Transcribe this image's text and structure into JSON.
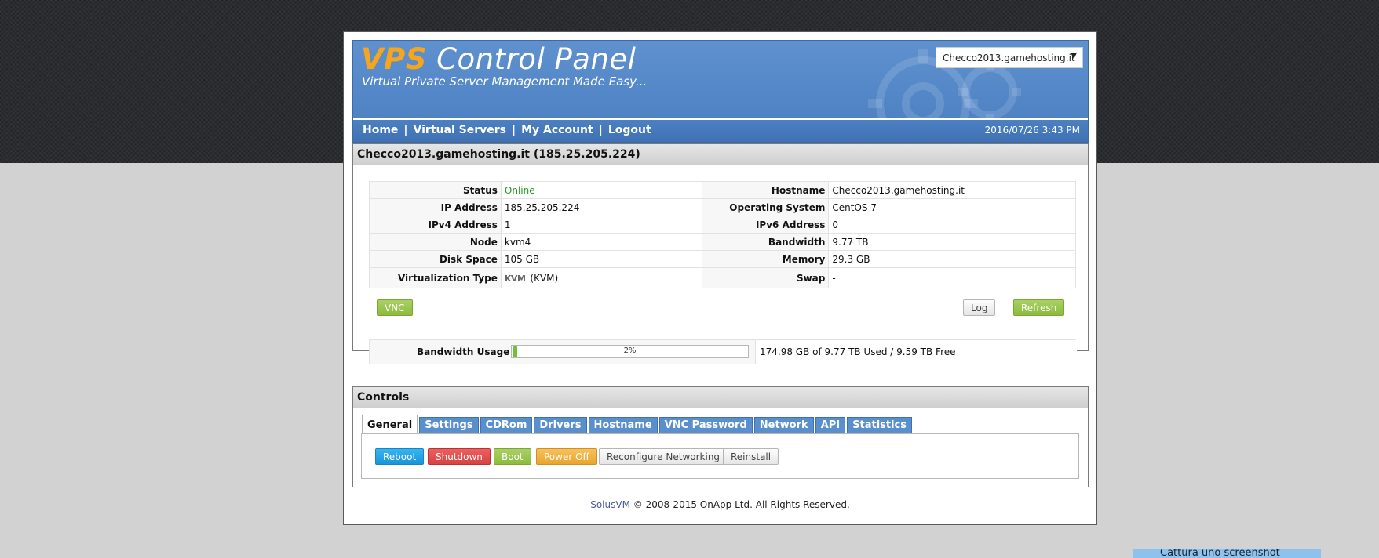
{
  "header": {
    "logo_vps": "VPS",
    "logo_rest": " Control Panel",
    "tagline": "Virtual Private Server Management Made Easy...",
    "server_select": "Checco2013.gamehosting.it",
    "datetime": "2016/07/26 3:43 PM"
  },
  "nav": {
    "home": "Home",
    "virtual_servers": "Virtual Servers",
    "my_account": "My Account",
    "logout": "Logout",
    "separator": "|"
  },
  "server_panel": {
    "title": "Checco2013.gamehosting.it (185.25.205.224)",
    "rows": [
      {
        "l1": "Status",
        "v1": "Online",
        "l2": "Hostname",
        "v2": "Checco2013.gamehosting.it"
      },
      {
        "l1": "IP Address",
        "v1": "185.25.205.224",
        "l2": "Operating System",
        "v2": "CentOS 7"
      },
      {
        "l1": "IPv4 Address",
        "v1": "1",
        "l2": "IPv6 Address",
        "v2": "0"
      },
      {
        "l1": "Node",
        "v1": "kvm4",
        "l2": "Bandwidth",
        "v2": "9.77 TB"
      },
      {
        "l1": "Disk Space",
        "v1": "105 GB",
        "l2": "Memory",
        "v2": "29.3 GB"
      },
      {
        "l1": "Virtualization Type",
        "v1": "(KVM)",
        "v1_logo": "KVM",
        "l2": "Swap",
        "v2": "-"
      }
    ],
    "vnc_label": "VNC",
    "log_label": "Log",
    "refresh_label": "Refresh",
    "bandwidth_label": "Bandwidth Usage",
    "bandwidth_percent": 2,
    "bandwidth_percent_text": "2%",
    "bandwidth_text": "174.98 GB of 9.77 TB Used / 9.59 TB Free"
  },
  "controls": {
    "title": "Controls",
    "tabs": [
      "General",
      "Settings",
      "CDRom",
      "Drivers",
      "Hostname",
      "VNC Password",
      "Network",
      "API",
      "Statistics"
    ],
    "buttons": {
      "reboot": "Reboot",
      "shutdown": "Shutdown",
      "boot": "Boot",
      "power_off": "Power Off",
      "reconfigure": "Reconfigure Networking",
      "reinstall": "Reinstall"
    }
  },
  "footer": {
    "brand": "SolusVM",
    "text": " © 2008-2015 OnApp Ltd. All Rights Reserved."
  },
  "tooltip": "Cattura uno screenshot",
  "colors": {
    "header_blue": "#4a7ec0",
    "logo_orange": "#f7a51c",
    "online_green": "#1f9a1f",
    "progress_green": "#6cc23a"
  }
}
